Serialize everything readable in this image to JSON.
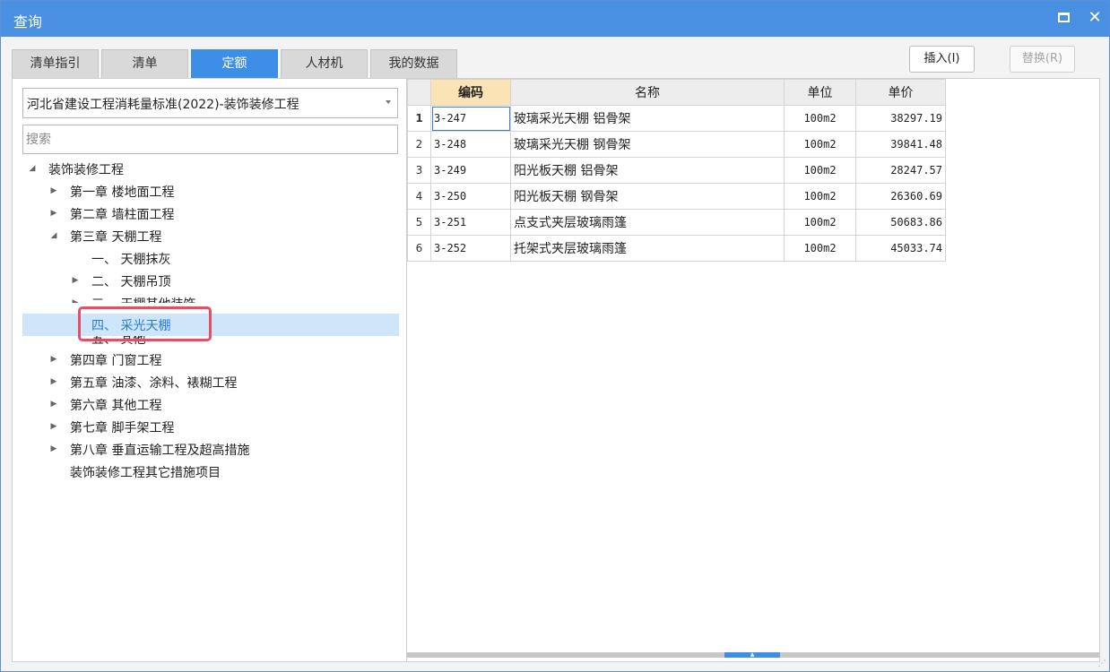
{
  "window": {
    "title": "查询",
    "close_glyph": "✕"
  },
  "tabs": [
    {
      "label": "清单指引",
      "active": false
    },
    {
      "label": "清单",
      "active": false
    },
    {
      "label": "定额",
      "active": true
    },
    {
      "label": "人材机",
      "active": false
    },
    {
      "label": "我的数据",
      "active": false
    }
  ],
  "actions": {
    "insert_label": "插入(I)",
    "replace_label": "替换(R)"
  },
  "library_select": {
    "value": "河北省建设工程消耗量标准(2022)-装饰装修工程"
  },
  "search": {
    "placeholder": "搜索"
  },
  "tree": [
    {
      "label": "装饰装修工程",
      "arrow": "◢"
    },
    {
      "label": "第一章 楼地面工程",
      "arrow": "▶"
    },
    {
      "label": "第二章 墙柱面工程",
      "arrow": "▶"
    },
    {
      "label": "第三章 天棚工程",
      "arrow": "◢"
    },
    {
      "label": "一、 天棚抹灰",
      "arrow": ""
    },
    {
      "label": "二、 天棚吊顶",
      "arrow": "▶"
    },
    {
      "label": "三、 天棚其他装饰",
      "arrow": "▶"
    },
    {
      "label": "四、 采光天棚",
      "arrow": ""
    },
    {
      "label": "五、 其他",
      "arrow": ""
    },
    {
      "label": "第四章 门窗工程",
      "arrow": "▶"
    },
    {
      "label": "第五章 油漆、涂料、裱糊工程",
      "arrow": "▶"
    },
    {
      "label": "第六章 其他工程",
      "arrow": "▶"
    },
    {
      "label": "第七章 脚手架工程",
      "arrow": "▶"
    },
    {
      "label": "第八章 垂直运输工程及超高措施",
      "arrow": "▶"
    },
    {
      "label": "装饰装修工程其它措施项目",
      "arrow": ""
    }
  ],
  "grid": {
    "headers": {
      "code": "编码",
      "name": "名称",
      "unit": "单位",
      "price": "单价"
    },
    "rows": [
      {
        "num": "1",
        "code": "3-247",
        "name": "玻璃采光天棚 铝骨架",
        "unit": "100m2",
        "price": "38297.19"
      },
      {
        "num": "2",
        "code": "3-248",
        "name": "玻璃采光天棚 钢骨架",
        "unit": "100m2",
        "price": "39841.48"
      },
      {
        "num": "3",
        "code": "3-249",
        "name": "阳光板天棚 铝骨架",
        "unit": "100m2",
        "price": "28247.57"
      },
      {
        "num": "4",
        "code": "3-250",
        "name": "阳光板天棚 钢骨架",
        "unit": "100m2",
        "price": "26360.69"
      },
      {
        "num": "5",
        "code": "3-251",
        "name": "点支式夹层玻璃雨篷",
        "unit": "100m2",
        "price": "50683.86"
      },
      {
        "num": "6",
        "code": "3-252",
        "name": "托架式夹层玻璃雨篷",
        "unit": "100m2",
        "price": "45033.74"
      }
    ]
  },
  "colors": {
    "accent": "#4a90e2",
    "selected_row": "#cde6fa",
    "highlight": "#e94c64",
    "sorted_header": "#fbe3b6"
  }
}
